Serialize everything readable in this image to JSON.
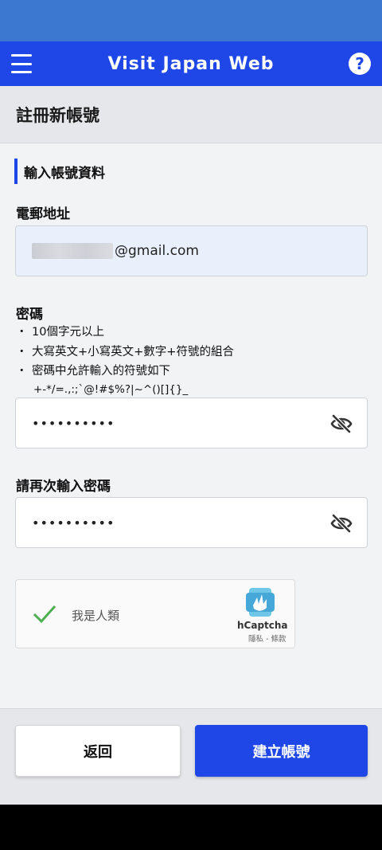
{
  "app": {
    "title": "Visit Japan Web"
  },
  "page": {
    "title": "註冊新帳號"
  },
  "section": {
    "title": "輸入帳號資料"
  },
  "email": {
    "label": "電郵地址",
    "value_suffix": "@gmail.com"
  },
  "password": {
    "label": "密碼",
    "rules": [
      "10個字元以上",
      "大寫英文+小寫英文+數字+符號的組合",
      "密碼中允許輸入的符號如下"
    ],
    "symbols": "+-*/=.,:;`@!#$%?|~^()[]{}_",
    "masked_value": "••••••••••"
  },
  "confirm_password": {
    "label": "請再次輸入密碼",
    "masked_value": "••••••••••"
  },
  "captcha": {
    "label": "我是人類",
    "brand": "hCaptcha",
    "links": "隱私 - 條款"
  },
  "buttons": {
    "back": "返回",
    "create": "建立帳號"
  },
  "bullet": "・",
  "colors": {
    "primary": "#1f47e8",
    "status_bar": "#3d78d0",
    "check": "#4caf50"
  }
}
